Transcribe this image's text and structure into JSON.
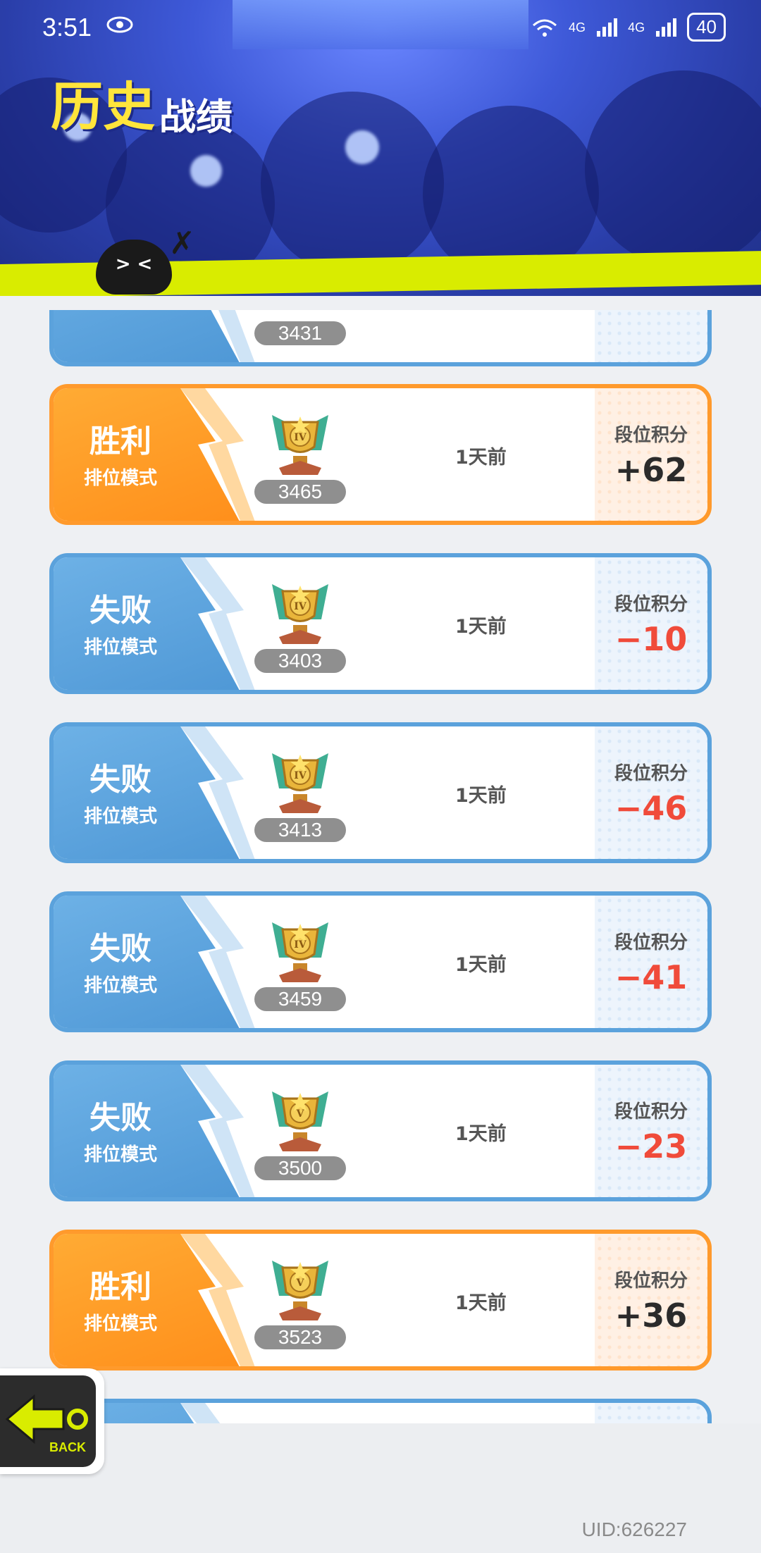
{
  "status_bar": {
    "time": "3:51",
    "network_1": "4G",
    "network_2": "4G",
    "battery": "40"
  },
  "header": {
    "title_big": "历史",
    "title_small": "战绩"
  },
  "mascot": {
    "face": "> <"
  },
  "list": {
    "partial_top": {
      "score": "3431"
    },
    "items": [
      {
        "result": "胜利",
        "mode": "排位模式",
        "score": "3465",
        "time": "1天前",
        "points_label": "段位积分",
        "points": "+62",
        "outcome": "win",
        "tier": "IV"
      },
      {
        "result": "失败",
        "mode": "排位模式",
        "score": "3403",
        "time": "1天前",
        "points_label": "段位积分",
        "points": "−10",
        "outcome": "lose",
        "tier": "IV"
      },
      {
        "result": "失败",
        "mode": "排位模式",
        "score": "3413",
        "time": "1天前",
        "points_label": "段位积分",
        "points": "−46",
        "outcome": "lose",
        "tier": "IV"
      },
      {
        "result": "失败",
        "mode": "排位模式",
        "score": "3459",
        "time": "1天前",
        "points_label": "段位积分",
        "points": "−41",
        "outcome": "lose",
        "tier": "IV"
      },
      {
        "result": "失败",
        "mode": "排位模式",
        "score": "3500",
        "time": "1天前",
        "points_label": "段位积分",
        "points": "−23",
        "outcome": "lose",
        "tier": "V"
      },
      {
        "result": "胜利",
        "mode": "排位模式",
        "score": "3523",
        "time": "1天前",
        "points_label": "段位积分",
        "points": "+36",
        "outcome": "win",
        "tier": "V"
      }
    ]
  },
  "back_button": {
    "label": "BACK"
  },
  "footer": {
    "uid": "UID:626227"
  },
  "colors": {
    "win": "#ff9a2c",
    "lose": "#5ba2dc",
    "loss_points": "#f04b3a",
    "accent_lime": "#d9ec00"
  }
}
